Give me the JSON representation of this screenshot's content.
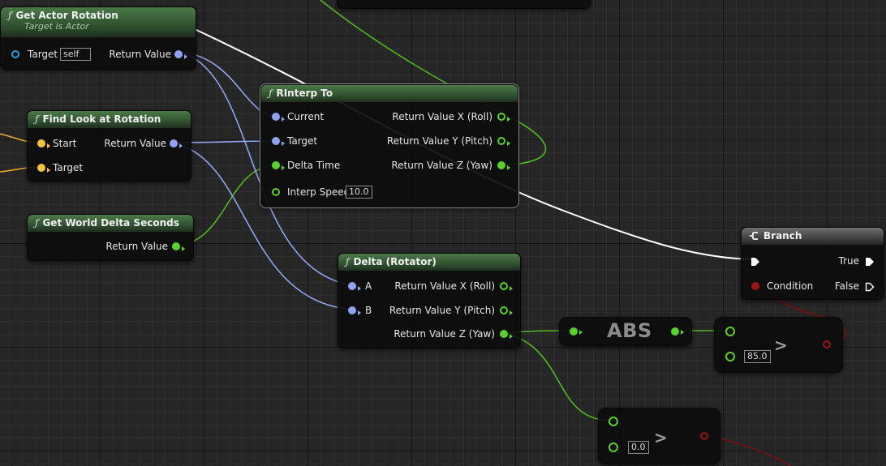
{
  "graph": {
    "nodes": {
      "get_actor_rotation": {
        "title": "Get Actor Rotation",
        "subtitle": "Target is Actor",
        "target_label": "Target",
        "target_value": "self",
        "return_label": "Return Value"
      },
      "find_look_at_rotation": {
        "title": "Find Look at Rotation",
        "start_label": "Start",
        "target_label": "Target",
        "return_label": "Return Value"
      },
      "get_world_delta_seconds": {
        "title": "Get World Delta Seconds",
        "return_label": "Return Value"
      },
      "rinterp_to": {
        "title": "RInterp To",
        "current_label": "Current",
        "target_label": "Target",
        "delta_time_label": "Delta Time",
        "interp_speed_label": "Interp Speed",
        "interp_speed_value": "10.0",
        "out_x": "Return Value X (Roll)",
        "out_y": "Return Value Y (Pitch)",
        "out_z": "Return Value Z (Yaw)"
      },
      "delta_rotator": {
        "title": "Delta (Rotator)",
        "a_label": "A",
        "b_label": "B",
        "out_x": "Return Value X (Roll)",
        "out_y": "Return Value Y (Pitch)",
        "out_z": "Return Value Z (Yaw)"
      },
      "abs": {
        "label": "ABS"
      },
      "greater_1": {
        "operator": ">",
        "value": "85.0"
      },
      "greater_2": {
        "operator": ">",
        "value": "0.0"
      },
      "branch": {
        "title": "Branch",
        "condition_label": "Condition",
        "true_label": "True",
        "false_label": "False"
      }
    },
    "pin_colors": {
      "rotator": "#8fa3f0",
      "vector": "#f5c242",
      "float": "#5bd12d",
      "boolean": "#9a1414",
      "object": "#2c9be6",
      "exec": "#ffffff"
    }
  }
}
